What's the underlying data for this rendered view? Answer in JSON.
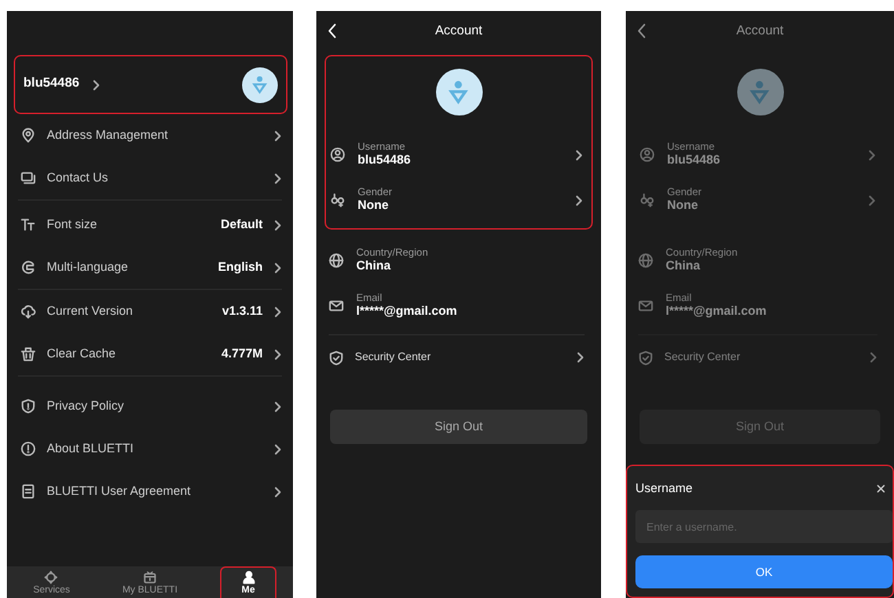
{
  "me_screen": {
    "profile": {
      "username": "blu54486",
      "highlighted": true
    },
    "menu_groups": [
      {
        "items": [
          {
            "label": "Address Management"
          },
          {
            "label": "Contact Us"
          }
        ]
      },
      {
        "items": [
          {
            "label": "Font size",
            "value": "Default"
          },
          {
            "label": "Multi-language",
            "value": "English"
          }
        ]
      },
      {
        "items": [
          {
            "label": "Current Version",
            "value": "v1.3.11"
          },
          {
            "label": "Clear Cache",
            "value": "4.777M"
          }
        ]
      },
      {
        "items": [
          {
            "label": "Privacy Policy"
          },
          {
            "label": "About BLUETTI"
          },
          {
            "label": "BLUETTI User Agreement"
          }
        ]
      }
    ],
    "tab_bar": [
      {
        "label": "Services",
        "selected": false,
        "highlighted": false
      },
      {
        "label": "My BLUETTI",
        "selected": false,
        "highlighted": false
      },
      {
        "label": "Me",
        "selected": true,
        "highlighted": true
      }
    ]
  },
  "account_screen": {
    "title": "Account",
    "dimmed": false,
    "highlighted": true,
    "profile_fields": [
      {
        "label": "Username",
        "value": "blu54486"
      },
      {
        "label": "Gender",
        "value": "None"
      }
    ],
    "info_fields": [
      {
        "label": "Country/Region",
        "value": "China"
      },
      {
        "label": "Email",
        "value": "l*****@gmail.com"
      }
    ],
    "security_center": "Security Center",
    "sign_out": "Sign Out"
  },
  "account_dialog_screen": {
    "title": "Account",
    "dimmed": true,
    "highlighted": false,
    "profile_fields": [
      {
        "label": "Username",
        "value": "blu54486"
      },
      {
        "label": "Gender",
        "value": "None"
      }
    ],
    "info_fields": [
      {
        "label": "Country/Region",
        "value": "China"
      },
      {
        "label": "Email",
        "value": "l*****@gmail.com"
      }
    ],
    "security_center": "Security Center",
    "sign_out": "Sign Out",
    "dialog": {
      "title": "Username",
      "placeholder": "Enter a username.",
      "ok": "OK",
      "highlighted": true
    }
  }
}
